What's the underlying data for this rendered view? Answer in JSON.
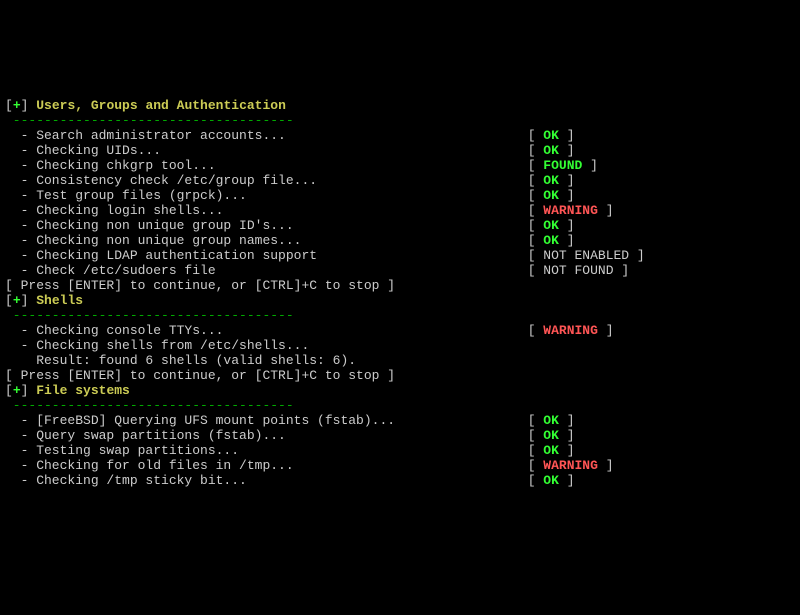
{
  "sections": [
    {
      "title": "Users, Groups and Authentication",
      "items": [
        {
          "label": "Search administrator accounts...",
          "status": "OK"
        },
        {
          "label": "Checking UIDs...",
          "status": "OK"
        },
        {
          "label": "Checking chkgrp tool...",
          "status": "FOUND"
        },
        {
          "label": "Consistency check /etc/group file...",
          "status": "OK"
        },
        {
          "label": "Test group files (grpck)...",
          "status": "OK"
        },
        {
          "label": "Checking login shells...",
          "status": "WARNING"
        },
        {
          "label": "Checking non unique group ID's...",
          "status": "OK"
        },
        {
          "label": "Checking non unique group names...",
          "status": "OK"
        },
        {
          "label": "Checking LDAP authentication support",
          "status": "NOT ENABLED"
        },
        {
          "label": "Check /etc/sudoers file",
          "status": "NOT FOUND"
        }
      ],
      "prompt": "[ Press [ENTER] to continue, or [CTRL]+C to stop ]"
    },
    {
      "title": "Shells",
      "items": [
        {
          "label": "Checking console TTYs...",
          "status": "WARNING"
        },
        {
          "label": "Checking shells from /etc/shells...",
          "extra": "Result: found 6 shells (valid shells: 6)."
        }
      ],
      "prompt": "[ Press [ENTER] to continue, or [CTRL]+C to stop ]"
    },
    {
      "title": "File systems",
      "items": [
        {
          "label": "[FreeBSD] Querying UFS mount points (fstab)...",
          "status": "OK"
        },
        {
          "label": "Query swap partitions (fstab)...",
          "status": "OK"
        },
        {
          "label": "Testing swap partitions...",
          "status": "OK"
        },
        {
          "label": "Checking for old files in /tmp...",
          "status": "WARNING"
        },
        {
          "label": "Checking /tmp sticky bit...",
          "status": "OK"
        }
      ]
    }
  ],
  "status_col": 67,
  "divider_len": 36,
  "statuses": {
    "OK": {
      "class": "brgreen"
    },
    "FOUND": {
      "class": "brgreen"
    },
    "WARNING": {
      "class": "red"
    },
    "NOT ENABLED": {
      "class": "white"
    },
    "NOT FOUND": {
      "class": "white"
    }
  }
}
